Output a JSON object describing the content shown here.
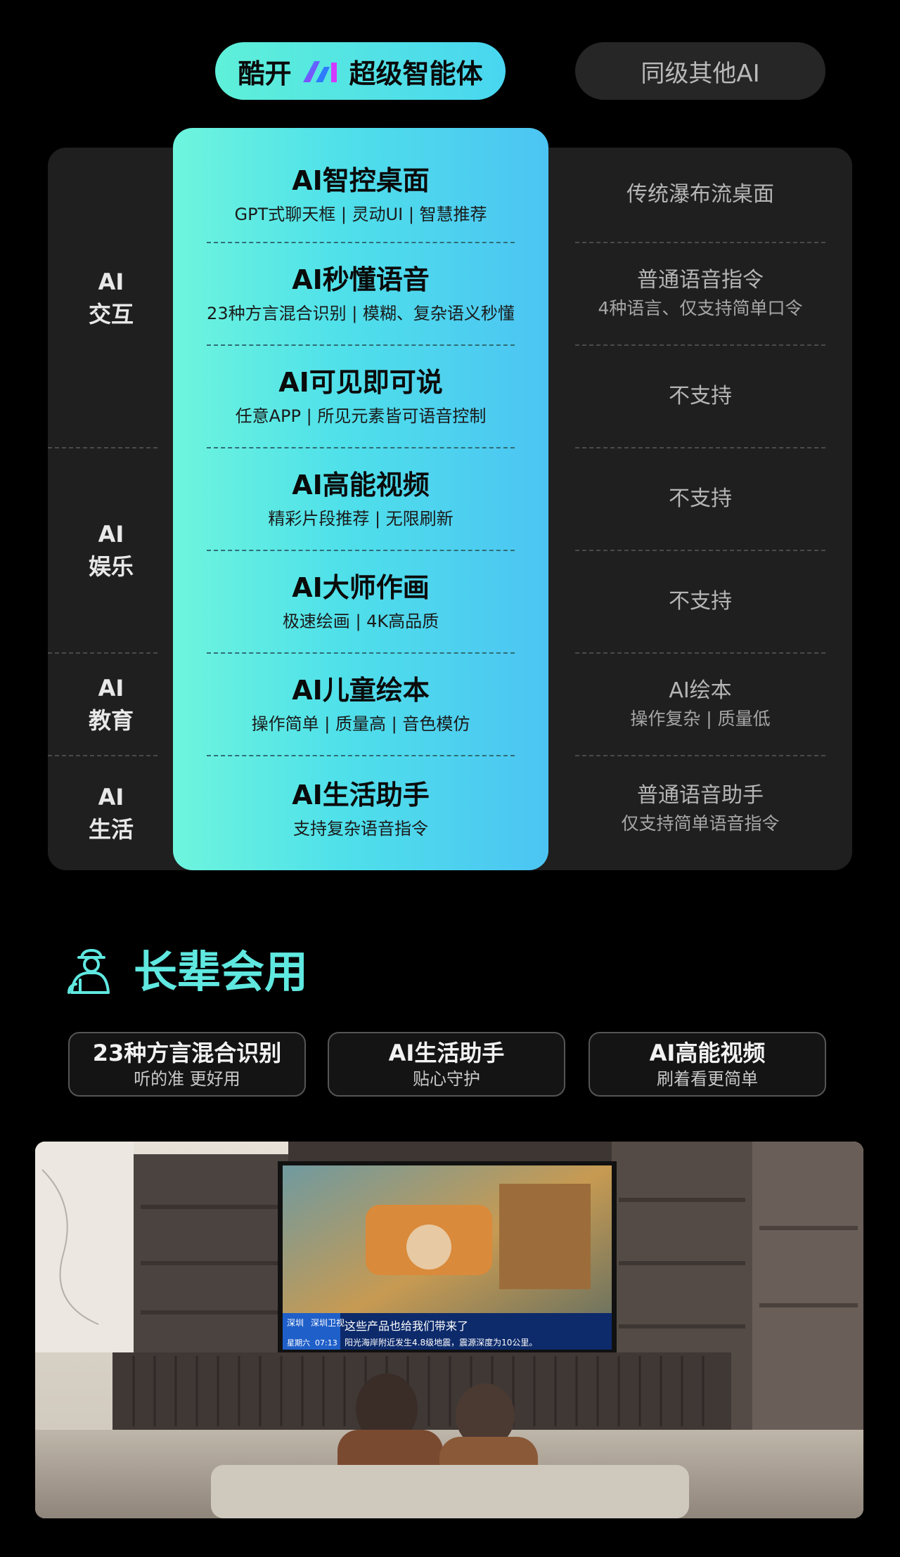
{
  "header": {
    "brand_left": "酷开",
    "brand_right": "超级智能体",
    "competitor": "同级其他AI"
  },
  "categories": [
    {
      "line1": "AI",
      "line2": "交互"
    },
    {
      "line1": "AI",
      "line2": "娱乐"
    },
    {
      "line1": "AI",
      "line2": "教育"
    },
    {
      "line1": "AI",
      "line2": "生活"
    }
  ],
  "features": [
    {
      "title": "AI智控桌面",
      "desc": "GPT式聊天框 | 灵动UI | 智慧推荐",
      "other_main": "传统瀑布流桌面",
      "other_sub": ""
    },
    {
      "title": "AI秒懂语音",
      "desc": "23种方言混合识别 | 模糊、复杂语义秒懂",
      "other_main": "普通语音指令",
      "other_sub": "4种语言、仅支持简单口令"
    },
    {
      "title": "AI可见即可说",
      "desc": "任意APP | 所见元素皆可语音控制",
      "other_main": "不支持",
      "other_sub": ""
    },
    {
      "title": "AI高能视频",
      "desc": "精彩片段推荐 | 无限刷新",
      "other_main": "不支持",
      "other_sub": ""
    },
    {
      "title": "AI大师作画",
      "desc": "极速绘画 | 4K高品质",
      "other_main": "不支持",
      "other_sub": ""
    },
    {
      "title": "AI儿童绘本",
      "desc": "操作简单 | 质量高 | 音色模仿",
      "other_main": "AI绘本",
      "other_sub": "操作复杂 | 质量低"
    },
    {
      "title": "AI生活助手",
      "desc": "支持复杂语音指令",
      "other_main": "普通语音助手",
      "other_sub": "仅支持简单语音指令"
    }
  ],
  "elder": {
    "title": "长辈会用",
    "cards": [
      {
        "title": "23种方言混合识别",
        "sub": "听的准 更好用"
      },
      {
        "title": "AI生活助手",
        "sub": "贴心守护"
      },
      {
        "title": "AI高能视频",
        "sub": "刷着看更简单"
      }
    ]
  },
  "tv_screen": {
    "city": "深圳",
    "channel": "深圳卫视",
    "time": "07:13",
    "weekday": "星期六",
    "headline": "这些产品也给我们带来了",
    "ticker": "阳光海岸附近发生4.8级地震，震源深度为10公里。"
  },
  "colors": {
    "accent": "#5fe8e0",
    "highlight_start": "#6ef5dd",
    "highlight_end": "#4cc4f3",
    "panel": "#1f1f1f"
  },
  "icons": {
    "brand": "ai-logo-icon",
    "elder": "elder-person-icon"
  }
}
